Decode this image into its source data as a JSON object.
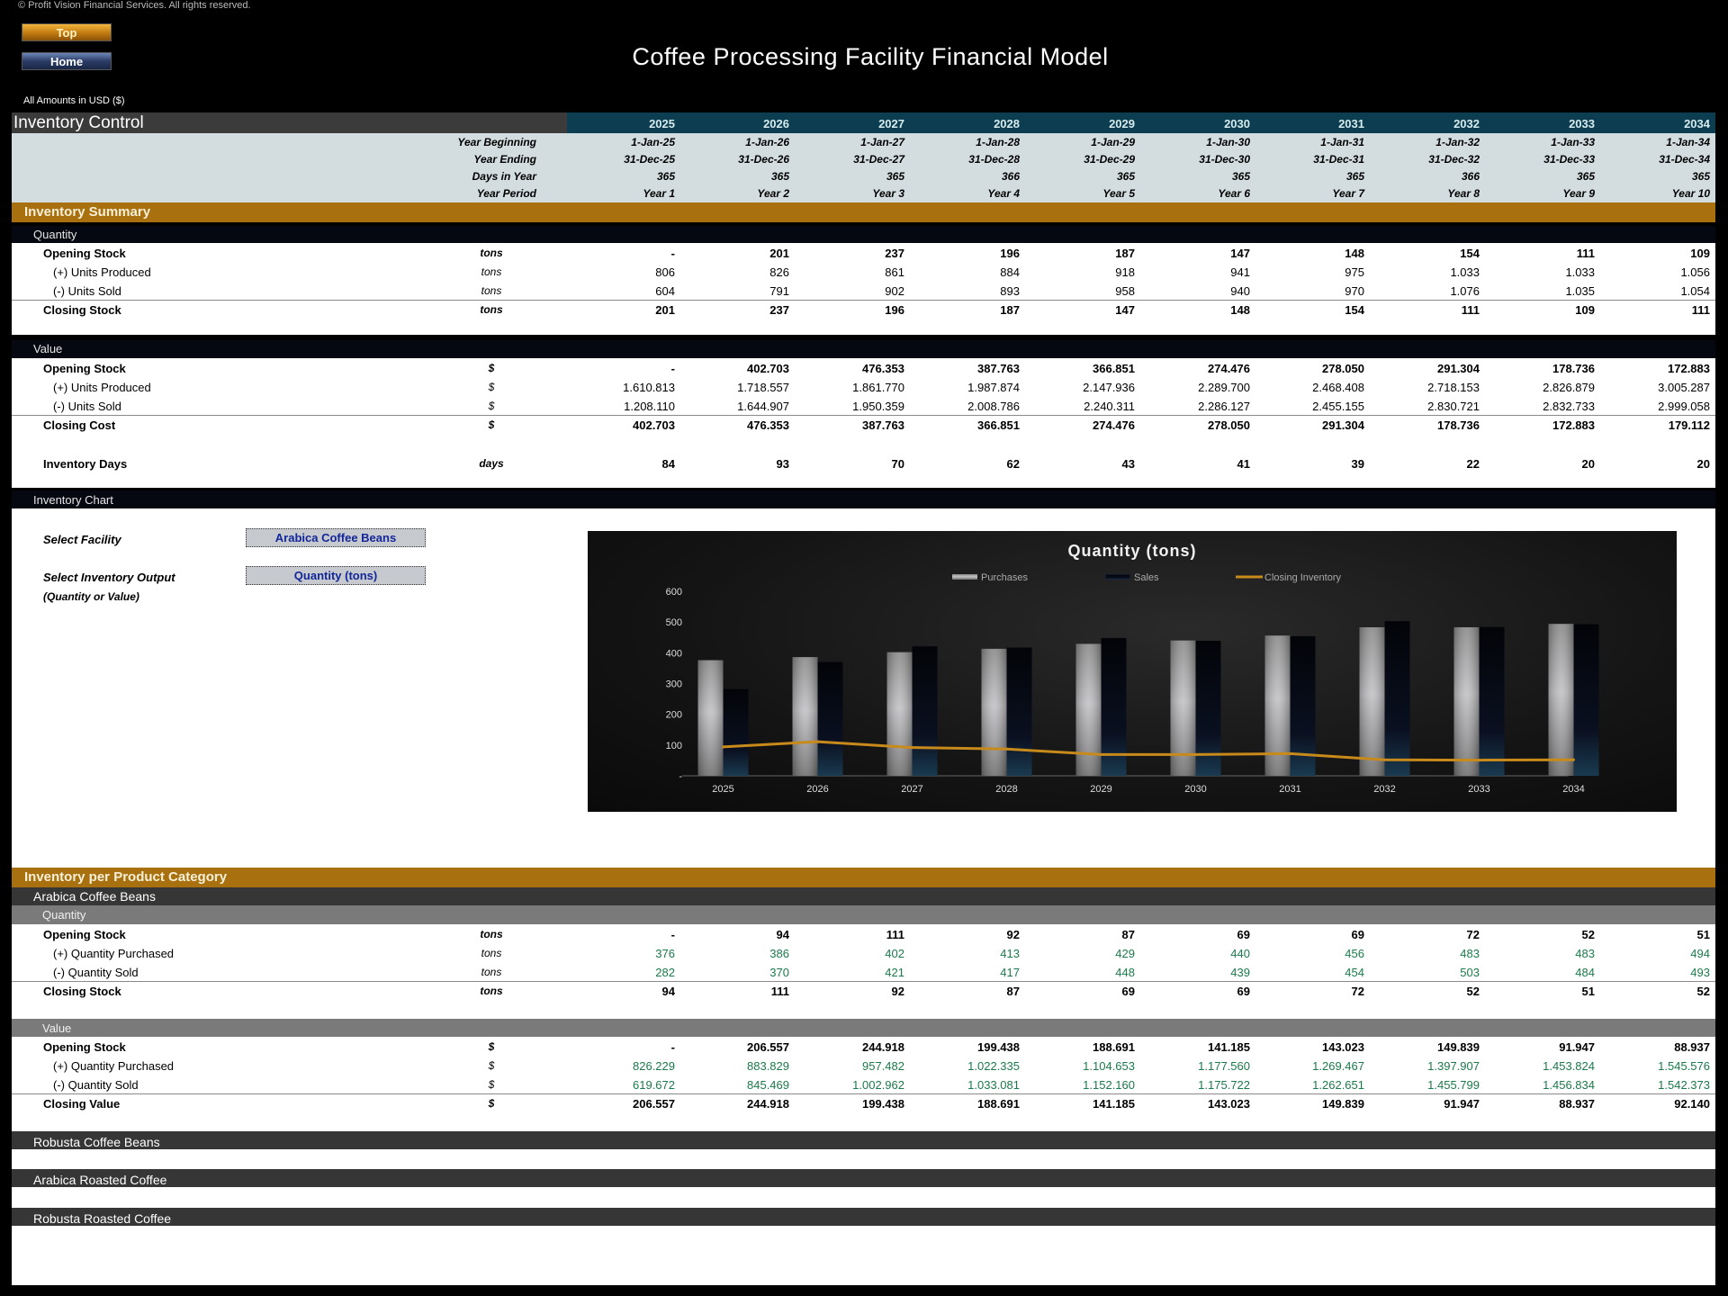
{
  "copyright": "© Profit Vision Financial Services. All rights reserved.",
  "nav": {
    "top_label": "Top",
    "home_label": "Home"
  },
  "title": "Coffee Processing Facility Financial Model",
  "currency_note": "All Amounts in  USD ($)",
  "header": {
    "section_title": "Inventory Control",
    "years": [
      "2025",
      "2026",
      "2027",
      "2028",
      "2029",
      "2030",
      "2031",
      "2032",
      "2033",
      "2034"
    ],
    "rows": [
      {
        "label": "Year Beginning",
        "values": [
          "1-Jan-25",
          "1-Jan-26",
          "1-Jan-27",
          "1-Jan-28",
          "1-Jan-29",
          "1-Jan-30",
          "1-Jan-31",
          "1-Jan-32",
          "1-Jan-33",
          "1-Jan-34"
        ]
      },
      {
        "label": "Year Ending",
        "values": [
          "31-Dec-25",
          "31-Dec-26",
          "31-Dec-27",
          "31-Dec-28",
          "31-Dec-29",
          "31-Dec-30",
          "31-Dec-31",
          "31-Dec-32",
          "31-Dec-33",
          "31-Dec-34"
        ]
      },
      {
        "label": "Days in Year",
        "values": [
          "365",
          "365",
          "365",
          "366",
          "365",
          "365",
          "365",
          "366",
          "365",
          "365"
        ]
      },
      {
        "label": "Year Period",
        "values": [
          "Year 1",
          "Year 2",
          "Year 3",
          "Year 4",
          "Year 5",
          "Year 6",
          "Year 7",
          "Year 8",
          "Year 9",
          "Year 10"
        ]
      }
    ]
  },
  "summary": {
    "title": "Inventory Summary",
    "quantity": {
      "label": "Quantity",
      "rows": [
        {
          "label": "Opening Stock",
          "unit": "tons",
          "style": "bold",
          "values": [
            "-",
            "201",
            "237",
            "196",
            "187",
            "147",
            "148",
            "154",
            "111",
            "109"
          ]
        },
        {
          "label": "(+) Units Produced",
          "unit": "tons",
          "style": "indent",
          "values": [
            "806",
            "826",
            "861",
            "884",
            "918",
            "941",
            "975",
            "1.033",
            "1.033",
            "1.056"
          ]
        },
        {
          "label": "(-) Units Sold",
          "unit": "tons",
          "style": "indent",
          "values": [
            "604",
            "791",
            "902",
            "893",
            "958",
            "940",
            "970",
            "1.076",
            "1.035",
            "1.054"
          ]
        },
        {
          "label": "Closing Stock",
          "unit": "tons",
          "style": "total",
          "values": [
            "201",
            "237",
            "196",
            "187",
            "147",
            "148",
            "154",
            "111",
            "109",
            "111"
          ]
        }
      ]
    },
    "value": {
      "label": "Value",
      "rows": [
        {
          "label": "Opening Stock",
          "unit": "$",
          "style": "bold",
          "values": [
            "-",
            "402.703",
            "476.353",
            "387.763",
            "366.851",
            "274.476",
            "278.050",
            "291.304",
            "178.736",
            "172.883"
          ]
        },
        {
          "label": "(+) Units Produced",
          "unit": "$",
          "style": "indent",
          "values": [
            "1.610.813",
            "1.718.557",
            "1.861.770",
            "1.987.874",
            "2.147.936",
            "2.289.700",
            "2.468.408",
            "2.718.153",
            "2.826.879",
            "3.005.287"
          ]
        },
        {
          "label": "(-) Units Sold",
          "unit": "$",
          "style": "indent",
          "values": [
            "1.208.110",
            "1.644.907",
            "1.950.359",
            "2.008.786",
            "2.240.311",
            "2.286.127",
            "2.455.155",
            "2.830.721",
            "2.832.733",
            "2.999.058"
          ]
        },
        {
          "label": "Closing Cost",
          "unit": "$",
          "style": "total",
          "values": [
            "402.703",
            "476.353",
            "387.763",
            "366.851",
            "274.476",
            "278.050",
            "291.304",
            "178.736",
            "172.883",
            "179.112"
          ]
        }
      ]
    },
    "inventory_days": {
      "label": "Inventory Days",
      "unit": "days",
      "values": [
        "84",
        "93",
        "70",
        "62",
        "43",
        "41",
        "39",
        "22",
        "20",
        "20"
      ]
    }
  },
  "chart_section": {
    "title": "Inventory Chart",
    "select_facility_label": "Select Facility",
    "select_facility_value": "Arabica Coffee Beans",
    "select_output_label": "Select Inventory Output",
    "select_output_hint": "(Quantity or Value)",
    "select_output_value": "Quantity (tons)"
  },
  "chart_data": {
    "type": "bar",
    "title": "Quantity (tons)",
    "categories": [
      "2025",
      "2026",
      "2027",
      "2028",
      "2029",
      "2030",
      "2031",
      "2032",
      "2033",
      "2034"
    ],
    "series": [
      {
        "name": "Purchases",
        "type": "bar",
        "color": "#9a9a9a",
        "values": [
          376,
          386,
          402,
          413,
          429,
          440,
          456,
          483,
          483,
          494
        ]
      },
      {
        "name": "Sales",
        "type": "bar",
        "color": "#0a0e18",
        "values": [
          282,
          370,
          421,
          417,
          448,
          439,
          454,
          503,
          484,
          493
        ]
      },
      {
        "name": "Closing Inventory",
        "type": "line",
        "color": "#c88a1a",
        "values": [
          94,
          111,
          92,
          87,
          69,
          69,
          72,
          52,
          51,
          52
        ]
      }
    ],
    "ylim": [
      0,
      600
    ],
    "yticks": [
      0,
      100,
      200,
      300,
      400,
      500,
      600
    ],
    "ytick_labels": [
      "-",
      "100",
      "200",
      "300",
      "400",
      "500",
      "600"
    ],
    "legend": "top",
    "grid": false,
    "xlabel": "",
    "ylabel": ""
  },
  "category_section": {
    "title": "Inventory per Product Category",
    "categories": [
      {
        "name": "Arabica Coffee Beans",
        "quantity": {
          "label": "Quantity",
          "rows": [
            {
              "label": "Opening Stock",
              "unit": "tons",
              "style": "bold",
              "values": [
                "-",
                "94",
                "111",
                "92",
                "87",
                "69",
                "69",
                "72",
                "52",
                "51"
              ]
            },
            {
              "label": "(+) Quantity Purchased",
              "unit": "tons",
              "style": "indent-green",
              "values": [
                "376",
                "386",
                "402",
                "413",
                "429",
                "440",
                "456",
                "483",
                "483",
                "494"
              ]
            },
            {
              "label": "(-) Quantity Sold",
              "unit": "tons",
              "style": "indent-green",
              "values": [
                "282",
                "370",
                "421",
                "417",
                "448",
                "439",
                "454",
                "503",
                "484",
                "493"
              ]
            },
            {
              "label": "Closing Stock",
              "unit": "tons",
              "style": "total",
              "values": [
                "94",
                "111",
                "92",
                "87",
                "69",
                "69",
                "72",
                "52",
                "51",
                "52"
              ]
            }
          ]
        },
        "value": {
          "label": "Value",
          "rows": [
            {
              "label": "Opening Stock",
              "unit": "$",
              "style": "bold",
              "values": [
                "-",
                "206.557",
                "244.918",
                "199.438",
                "188.691",
                "141.185",
                "143.023",
                "149.839",
                "91.947",
                "88.937"
              ]
            },
            {
              "label": "(+) Quantity Purchased",
              "unit": "$",
              "style": "indent-green",
              "values": [
                "826.229",
                "883.829",
                "957.482",
                "1.022.335",
                "1.104.653",
                "1.177.560",
                "1.269.467",
                "1.397.907",
                "1.453.824",
                "1.545.576"
              ]
            },
            {
              "label": "(-) Quantity Sold",
              "unit": "$",
              "style": "indent-green",
              "values": [
                "619.672",
                "845.469",
                "1.002.962",
                "1.033.081",
                "1.152.160",
                "1.175.722",
                "1.262.651",
                "1.455.799",
                "1.456.834",
                "1.542.373"
              ]
            },
            {
              "label": "Closing Value",
              "unit": "$",
              "style": "total",
              "values": [
                "206.557",
                "244.918",
                "199.438",
                "188.691",
                "141.185",
                "143.023",
                "149.839",
                "91.947",
                "88.937",
                "92.140"
              ]
            }
          ]
        }
      }
    ],
    "collapsed_categories": [
      "Robusta Coffee Beans",
      "Arabica Roasted Coffee",
      "Robusta Roasted Coffee"
    ]
  }
}
